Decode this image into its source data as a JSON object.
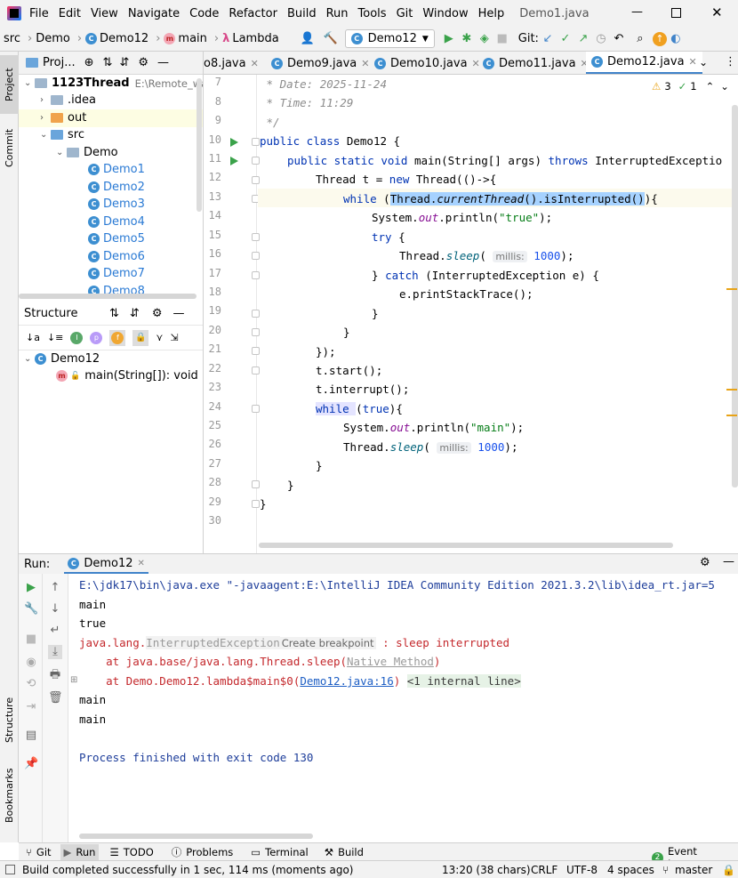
{
  "menubar": {
    "items": [
      "File",
      "Edit",
      "View",
      "Navigate",
      "Code",
      "Refactor",
      "Build",
      "Run",
      "Tools",
      "Git",
      "Window",
      "Help"
    ],
    "title": "Demo1.java"
  },
  "navbar": {
    "crumbs": [
      "src",
      "Demo",
      "Demo12",
      "main",
      "Lambda"
    ],
    "run_config": "Demo12",
    "git_label": "Git:"
  },
  "left_strip": {
    "project": "Project",
    "commit": "Commit",
    "structure": "Structure",
    "bookmarks": "Bookmarks"
  },
  "project_panel": {
    "header": "Proj...",
    "root": {
      "name": "1123Thread",
      "path": "E:\\Remote_ware"
    },
    "items": [
      {
        "name": ".idea"
      },
      {
        "name": "out"
      },
      {
        "name": "src"
      },
      {
        "name": "Demo"
      },
      {
        "name": "Demo1"
      },
      {
        "name": "Demo2"
      },
      {
        "name": "Demo3"
      },
      {
        "name": "Demo4"
      },
      {
        "name": "Demo5"
      },
      {
        "name": "Demo6"
      },
      {
        "name": "Demo7"
      },
      {
        "name": "Demo8"
      }
    ]
  },
  "structure_panel": {
    "title": "Structure",
    "class_name": "Demo12",
    "method": "main(String[]): void"
  },
  "editor": {
    "tabs": [
      "o8.java",
      "Demo9.java",
      "Demo10.java",
      "Demo11.java",
      "Demo12.java"
    ],
    "warnings": "3",
    "checks": "1",
    "line_numbers": [
      "7",
      "8",
      "9",
      "10",
      "11",
      "12",
      "13",
      "14",
      "15",
      "16",
      "17",
      "18",
      "19",
      "20",
      "21",
      "22",
      "23",
      "24",
      "25",
      "26",
      "27",
      "28",
      "29",
      "30"
    ],
    "code": {
      "l7": " * Date: 2025-11-24",
      "l8": " * Time: 11:29",
      "l9": " */",
      "l10_kw": "public class ",
      "l10_rest": "Demo12 {",
      "l11_kw": "public static void ",
      "l11_mid": "main(String[] args) ",
      "l11_kw2": "throws ",
      "l11_rest": "InterruptedExceptio",
      "l12_a": "Thread t = ",
      "l12_kw": "new ",
      "l12_b": "Thread(()->{",
      "l13_kw": "while ",
      "l13_a": "(",
      "l13_sel_a": "Thread.",
      "l13_sel_b": "currentThread",
      "l13_sel_c": "().isInterrupted()",
      "l13_b": "){",
      "l14_a": "System.",
      "l14_f": "out",
      "l14_b": ".println(",
      "l14_s": "\"true\"",
      "l14_c": ");",
      "l15_kw": "try ",
      "l15_a": "{",
      "l16_a": "Thread.",
      "l16_m": "sleep",
      "l16_b": "( ",
      "l16_h": "millis:",
      "l16_n": " 1000",
      "l16_c": ");",
      "l17_a": "} ",
      "l17_kw": "catch ",
      "l17_b": "(InterruptedException e) {",
      "l18": "e.printStackTrace();",
      "l19": "}",
      "l20": "}",
      "l21": "});",
      "l22": "t.start();",
      "l23": "t.interrupt();",
      "l24_kw": "while ",
      "l24_a": "(",
      "l24_kw2": "true",
      "l24_b": "){",
      "l25_a": "System.",
      "l25_f": "out",
      "l25_b": ".println(",
      "l25_s": "\"main\"",
      "l25_c": ");",
      "l26_a": "Thread.",
      "l26_m": "sleep",
      "l26_b": "( ",
      "l26_h": "millis:",
      "l26_n": " 1000",
      "l26_c": ");",
      "l27": "}",
      "l28": "}",
      "l29": "}"
    }
  },
  "run_panel": {
    "label": "Run:",
    "tab": "Demo12",
    "output": {
      "cmd": "E:\\jdk17\\bin\\java.exe \"-javaagent:E:\\IntelliJ IDEA Community Edition 2021.3.2\\lib\\idea_rt.jar=5",
      "l1": "main",
      "l2": "true",
      "ex_a": "java.lang.",
      "ex_b": "InterruptedException",
      "ex_bp": "Create breakpoint",
      "ex_c": " : sleep interrupted",
      "at1_a": "    at java.base/java.lang.Thread.sleep(",
      "at1_b": "Native Method",
      "at1_c": ")",
      "at2_a": "    at Demo.Demo12.lambda$main$0(",
      "at2_link": "Demo12.java:16",
      "at2_b": ") ",
      "at2_c": "<1 internal line>",
      "l3": "main",
      "l4": "main",
      "finish": "Process finished with exit code 130"
    }
  },
  "bottom_tabs": [
    "Git",
    "Run",
    "TODO",
    "Problems",
    "Terminal",
    "Build"
  ],
  "event_log": "Event Log",
  "status": {
    "message": "Build completed successfully in 1 sec, 114 ms (moments ago)",
    "position": "13:20 (38 chars)",
    "line_sep": "CRLF",
    "encoding": "UTF-8",
    "indent": "4 spaces",
    "branch": "master"
  },
  "colors": {
    "accent": "#4083c9",
    "keyword": "#0033b3",
    "string": "#067d17",
    "error": "#c4282c",
    "run_green": "#3aa24a"
  }
}
